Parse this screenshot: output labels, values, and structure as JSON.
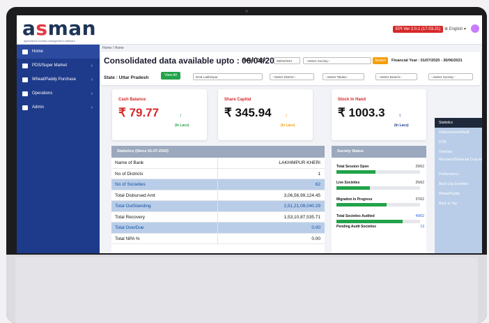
{
  "app": {
    "logo_left": "a",
    "logo_mid": "s",
    "logo_right": "man",
    "tagline": "agricultural society management software",
    "version_badge": "EPI Ver 2.0.1 (17.03.21)",
    "language": "English ▾"
  },
  "sidebar": {
    "items": [
      {
        "label": "Home",
        "icon": "home-icon",
        "has_arrow": false
      },
      {
        "label": "PDS/Super Market",
        "icon": "store-icon",
        "has_arrow": true
      },
      {
        "label": "Wheat/Paddy Purchase",
        "icon": "monitor-icon",
        "has_arrow": true
      },
      {
        "label": "Operations",
        "icon": "folder-icon",
        "has_arrow": true
      },
      {
        "label": "Admin",
        "icon": "user-icon",
        "has_arrow": true
      }
    ]
  },
  "breadcrumb": "Home  /  Home",
  "header": {
    "title": "Consolidated data available upto : 06/04/2021",
    "select_date_label": "Select Date",
    "date_value": "06/04/2021",
    "society_select": "--Select Society--",
    "search_label": "Search",
    "financial_year": "Financial Year : 01/07/2020 - 30/06/2021",
    "state_label": "State : Uttar Pradesh",
    "view_all_label": "View All",
    "filters": [
      "DCB Lakhimpur",
      "--Select District--",
      "--Select Taluka--",
      "--Select Branch--",
      "--Select Society--"
    ]
  },
  "stats": [
    {
      "label": "Cash Balance",
      "value": "₹ 79.77",
      "unit": "(In Lacs)",
      "color": "#d62828",
      "unit_color": "#22a34a",
      "arrow_color": "#22a34a"
    },
    {
      "label": "Share Capital",
      "value": "₹ 345.94",
      "unit": "(In Lacs)",
      "color": "#111111",
      "unit_color": "#f59e0b",
      "arrow_color": "#f59e0b"
    },
    {
      "label": "Stock In Hand",
      "value": "₹ 1003.3",
      "unit": "(In Lacs)",
      "color": "#111111",
      "unit_color": "#1e3a8a",
      "arrow_color": "#1e3a8a"
    }
  ],
  "statistics": {
    "title": "Statistics (Since 01-07-2020)",
    "rows": [
      {
        "label": "Name of Bank",
        "value": "LAKHIMPUR KHERI",
        "highlight": false
      },
      {
        "label": "No of Districts",
        "value": "1",
        "highlight": false
      },
      {
        "label": "No of Societies",
        "value": "62",
        "highlight": true
      },
      {
        "label": "Total Disbursed Amt",
        "value": "3,06,56,99,124.45",
        "highlight": false
      },
      {
        "label": "Total OutStanding",
        "value": "2,51,21,09,040.29",
        "highlight": true
      },
      {
        "label": "Total Recovery",
        "value": "1,53,10,87,535.71",
        "highlight": false
      },
      {
        "label": "Total OverDue",
        "value": "0.00",
        "highlight": true
      },
      {
        "label": "Total NPA %",
        "value": "0.00",
        "highlight": false
      }
    ]
  },
  "society_status": {
    "title": "Society Status",
    "items": [
      {
        "label": "Total Session Open",
        "count": "29/62",
        "progress": 0.47
      },
      {
        "label": "Live Societies",
        "count": "25/62",
        "progress": 0.4
      },
      {
        "label": "Migration In Progress",
        "count": "37/62",
        "progress": 0.6
      },
      {
        "label": "Total Societies Audited",
        "count": "49/62",
        "progress": 0.79
      },
      {
        "label": "Pending Audit Societies",
        "count": "13",
        "progress": null
      }
    ]
  },
  "right_menu": [
    "Statistics",
    "Disbursement/Audit",
    "DCB",
    "Overdue",
    "Recovery/Disbursal Crop wise",
    "Performance",
    "Back Log Societies",
    "Wheat/Paddy",
    "Back to Top"
  ]
}
